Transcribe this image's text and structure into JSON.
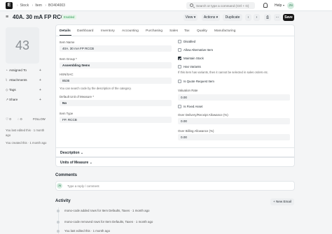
{
  "navbar": {
    "logo_letter": "E",
    "breadcrumbs": [
      "Stock",
      "Item",
      "BO404003"
    ],
    "search_placeholder": "Search or type a command (Ctrl + G)",
    "help_label": "Help",
    "user_initials": "JN"
  },
  "header": {
    "title": "40A. 30 mA FP RCCB",
    "status_badge": "Enabled",
    "view_label": "View",
    "actions_label": "Actions",
    "duplicate_label": "Duplicate",
    "save_label": "Save"
  },
  "sidebar": {
    "image_placeholder": "43",
    "items": [
      {
        "label": "Assigned To"
      },
      {
        "label": "Attachments"
      },
      {
        "label": "Tags"
      },
      {
        "label": "Share"
      }
    ],
    "likes_count": "0",
    "comments_count": "0",
    "follow_label": "FOLLOW",
    "last_edited": "You last edited this · 1 month ago",
    "created": "You created this · 1 month ago"
  },
  "tabs": [
    "Details",
    "Dashboard",
    "Inventory",
    "Accounting",
    "Purchasing",
    "Sales",
    "Tax",
    "Quality",
    "Manufacturing"
  ],
  "active_tab": "Details",
  "details": {
    "left": {
      "item_name_label": "Item Name",
      "item_name_value": "40A. 30 mA  FP RCCB",
      "item_group_label": "Item Group *",
      "item_group_value": "Assembling Items",
      "hsn_label": "HSN/SAC",
      "hsn_value": "8536",
      "hsn_desc": "You can search code by the description of the category.",
      "uom_label": "Default Unit of Measure *",
      "uom_value": "No",
      "item_type_label": "Item Type",
      "item_type_value": "FP. RCCB"
    },
    "right": {
      "checkboxes": [
        {
          "label": "Disabled",
          "checked": false
        },
        {
          "label": "Allow Alternative Item",
          "checked": false
        },
        {
          "label": "Maintain Stock",
          "checked": true
        },
        {
          "label": "Has Variants",
          "checked": false
        }
      ],
      "variants_desc": "If this item has variants, then it cannot be selected in sales orders etc.",
      "quote_label": "Is Quote Request Item",
      "valuation_label": "Valuation Rate",
      "valuation_value": "0.00",
      "fixed_asset_label": "Is Fixed Asset",
      "over_delivery_label": "Over Delivery/Receipt Allowance (%)",
      "over_delivery_value": "0.00",
      "over_billing_label": "Over Billing Allowance (%)",
      "over_billing_value": "0.00"
    }
  },
  "sections": [
    {
      "title": "Description"
    },
    {
      "title": "Units of Measure"
    }
  ],
  "comments": {
    "heading": "Comments",
    "avatar_initials": "JN",
    "placeholder": "Type a reply / comment"
  },
  "activity": {
    "heading": "Activity",
    "new_email_label": "+ New Email",
    "entries": [
      "mono-code added rows for Item Defaults, Taxes · 1 month ago",
      "mono-code removed rows for Item Defaults, Taxes · 1 month ago",
      "You last edited this · 1 month ago"
    ]
  }
}
